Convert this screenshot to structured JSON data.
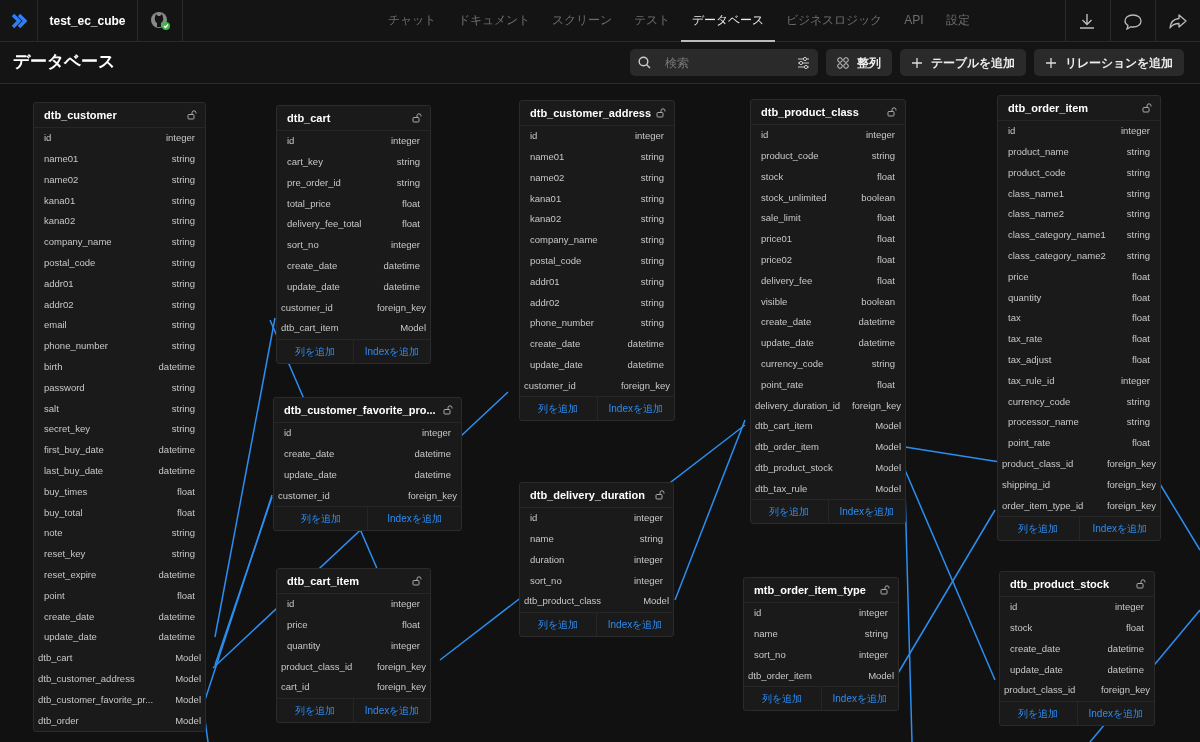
{
  "app": {
    "project": "test_ec_cube"
  },
  "nav": [
    {
      "label": "チャット",
      "selected": false
    },
    {
      "label": "ドキュメント",
      "selected": false
    },
    {
      "label": "スクリーン",
      "selected": false
    },
    {
      "label": "テスト",
      "selected": false
    },
    {
      "label": "データベース",
      "selected": true
    },
    {
      "label": "ビジネスロジック",
      "selected": false
    },
    {
      "label": "API",
      "selected": false
    },
    {
      "label": "設定",
      "selected": false
    }
  ],
  "page": {
    "title": "データベース",
    "search": {
      "placeholder": "検索"
    },
    "buttons": [
      {
        "kind": "arrange",
        "label": "整列"
      },
      {
        "kind": "add",
        "label": "テーブルを追加"
      },
      {
        "kind": "add",
        "label": "リレーションを追加"
      }
    ]
  },
  "tables": [
    {
      "name": "dtb_customer",
      "columns": [
        {
          "name": "id",
          "type": "integer",
          "kind": "field"
        },
        {
          "name": "name01",
          "type": "string",
          "kind": "field"
        },
        {
          "name": "name02",
          "type": "string",
          "kind": "field"
        },
        {
          "name": "kana01",
          "type": "string",
          "kind": "field"
        },
        {
          "name": "kana02",
          "type": "string",
          "kind": "field"
        },
        {
          "name": "company_name",
          "type": "string",
          "kind": "field"
        },
        {
          "name": "postal_code",
          "type": "string",
          "kind": "field"
        },
        {
          "name": "addr01",
          "type": "string",
          "kind": "field"
        },
        {
          "name": "addr02",
          "type": "string",
          "kind": "field"
        },
        {
          "name": "email",
          "type": "string",
          "kind": "field"
        },
        {
          "name": "phone_number",
          "type": "string",
          "kind": "field"
        },
        {
          "name": "birth",
          "type": "datetime",
          "kind": "field"
        },
        {
          "name": "password",
          "type": "string",
          "kind": "field"
        },
        {
          "name": "salt",
          "type": "string",
          "kind": "field"
        },
        {
          "name": "secret_key",
          "type": "string",
          "kind": "field"
        },
        {
          "name": "first_buy_date",
          "type": "datetime",
          "kind": "field"
        },
        {
          "name": "last_buy_date",
          "type": "datetime",
          "kind": "field"
        },
        {
          "name": "buy_times",
          "type": "float",
          "kind": "field"
        },
        {
          "name": "buy_total",
          "type": "float",
          "kind": "field"
        },
        {
          "name": "note",
          "type": "string",
          "kind": "field"
        },
        {
          "name": "reset_key",
          "type": "string",
          "kind": "field"
        },
        {
          "name": "reset_expire",
          "type": "datetime",
          "kind": "field"
        },
        {
          "name": "point",
          "type": "float",
          "kind": "field"
        },
        {
          "name": "create_date",
          "type": "datetime",
          "kind": "field"
        },
        {
          "name": "update_date",
          "type": "datetime",
          "kind": "field"
        },
        {
          "name": "dtb_cart",
          "type": "Model",
          "kind": "link"
        },
        {
          "name": "dtb_customer_address",
          "type": "Model",
          "kind": "link"
        },
        {
          "name": "dtb_customer_favorite_pr...",
          "type": "Model",
          "kind": "link"
        },
        {
          "name": "dtb_order",
          "type": "Model",
          "kind": "link"
        }
      ]
    },
    {
      "name": "dtb_cart",
      "columns": [
        {
          "name": "id",
          "type": "integer",
          "kind": "field"
        },
        {
          "name": "cart_key",
          "type": "string",
          "kind": "field"
        },
        {
          "name": "pre_order_id",
          "type": "string",
          "kind": "field"
        },
        {
          "name": "total_price",
          "type": "float",
          "kind": "field"
        },
        {
          "name": "delivery_fee_total",
          "type": "float",
          "kind": "field"
        },
        {
          "name": "sort_no",
          "type": "integer",
          "kind": "field"
        },
        {
          "name": "create_date",
          "type": "datetime",
          "kind": "field"
        },
        {
          "name": "update_date",
          "type": "datetime",
          "kind": "field"
        },
        {
          "name": "customer_id",
          "type": "foreign_key",
          "kind": "link"
        },
        {
          "name": "dtb_cart_item",
          "type": "Model",
          "kind": "link"
        }
      ],
      "actions": [
        "列を追加",
        "Indexを追加"
      ]
    },
    {
      "name": "dtb_customer_favorite_pro...",
      "columns": [
        {
          "name": "id",
          "type": "integer",
          "kind": "field"
        },
        {
          "name": "create_date",
          "type": "datetime",
          "kind": "field"
        },
        {
          "name": "update_date",
          "type": "datetime",
          "kind": "field"
        },
        {
          "name": "customer_id",
          "type": "foreign_key",
          "kind": "link"
        }
      ],
      "actions": [
        "列を追加",
        "Indexを追加"
      ]
    },
    {
      "name": "dtb_cart_item",
      "columns": [
        {
          "name": "id",
          "type": "integer",
          "kind": "field"
        },
        {
          "name": "price",
          "type": "float",
          "kind": "field"
        },
        {
          "name": "quantity",
          "type": "integer",
          "kind": "field"
        },
        {
          "name": "product_class_id",
          "type": "foreign_key",
          "kind": "link"
        },
        {
          "name": "cart_id",
          "type": "foreign_key",
          "kind": "link"
        }
      ],
      "actions": [
        "列を追加",
        "Indexを追加"
      ]
    },
    {
      "name": "dtb_customer_address",
      "columns": [
        {
          "name": "id",
          "type": "integer",
          "kind": "field"
        },
        {
          "name": "name01",
          "type": "string",
          "kind": "field"
        },
        {
          "name": "name02",
          "type": "string",
          "kind": "field"
        },
        {
          "name": "kana01",
          "type": "string",
          "kind": "field"
        },
        {
          "name": "kana02",
          "type": "string",
          "kind": "field"
        },
        {
          "name": "company_name",
          "type": "string",
          "kind": "field"
        },
        {
          "name": "postal_code",
          "type": "string",
          "kind": "field"
        },
        {
          "name": "addr01",
          "type": "string",
          "kind": "field"
        },
        {
          "name": "addr02",
          "type": "string",
          "kind": "field"
        },
        {
          "name": "phone_number",
          "type": "string",
          "kind": "field"
        },
        {
          "name": "create_date",
          "type": "datetime",
          "kind": "field"
        },
        {
          "name": "update_date",
          "type": "datetime",
          "kind": "field"
        },
        {
          "name": "customer_id",
          "type": "foreign_key",
          "kind": "link"
        }
      ],
      "actions": [
        "列を追加",
        "Indexを追加"
      ]
    },
    {
      "name": "dtb_delivery_duration",
      "columns": [
        {
          "name": "id",
          "type": "integer",
          "kind": "field"
        },
        {
          "name": "name",
          "type": "string",
          "kind": "field"
        },
        {
          "name": "duration",
          "type": "integer",
          "kind": "field"
        },
        {
          "name": "sort_no",
          "type": "integer",
          "kind": "field"
        },
        {
          "name": "dtb_product_class",
          "type": "Model",
          "kind": "link"
        }
      ],
      "actions": [
        "列を追加",
        "Indexを追加"
      ]
    },
    {
      "name": "dtb_product_class",
      "columns": [
        {
          "name": "id",
          "type": "integer",
          "kind": "field"
        },
        {
          "name": "product_code",
          "type": "string",
          "kind": "field"
        },
        {
          "name": "stock",
          "type": "float",
          "kind": "field"
        },
        {
          "name": "stock_unlimited",
          "type": "boolean",
          "kind": "field"
        },
        {
          "name": "sale_limit",
          "type": "float",
          "kind": "field"
        },
        {
          "name": "price01",
          "type": "float",
          "kind": "field"
        },
        {
          "name": "price02",
          "type": "float",
          "kind": "field"
        },
        {
          "name": "delivery_fee",
          "type": "float",
          "kind": "field"
        },
        {
          "name": "visible",
          "type": "boolean",
          "kind": "field"
        },
        {
          "name": "create_date",
          "type": "datetime",
          "kind": "field"
        },
        {
          "name": "update_date",
          "type": "datetime",
          "kind": "field"
        },
        {
          "name": "currency_code",
          "type": "string",
          "kind": "field"
        },
        {
          "name": "point_rate",
          "type": "float",
          "kind": "field"
        },
        {
          "name": "delivery_duration_id",
          "type": "foreign_key",
          "kind": "link"
        },
        {
          "name": "dtb_cart_item",
          "type": "Model",
          "kind": "link"
        },
        {
          "name": "dtb_order_item",
          "type": "Model",
          "kind": "link"
        },
        {
          "name": "dtb_product_stock",
          "type": "Model",
          "kind": "link"
        },
        {
          "name": "dtb_tax_rule",
          "type": "Model",
          "kind": "link"
        }
      ],
      "actions": [
        "列を追加",
        "Indexを追加"
      ]
    },
    {
      "name": "mtb_order_item_type",
      "columns": [
        {
          "name": "id",
          "type": "integer",
          "kind": "field"
        },
        {
          "name": "name",
          "type": "string",
          "kind": "field"
        },
        {
          "name": "sort_no",
          "type": "integer",
          "kind": "field"
        },
        {
          "name": "dtb_order_item",
          "type": "Model",
          "kind": "link"
        }
      ],
      "actions": [
        "列を追加",
        "Indexを追加"
      ]
    },
    {
      "name": "dtb_order_item",
      "columns": [
        {
          "name": "id",
          "type": "integer",
          "kind": "field"
        },
        {
          "name": "product_name",
          "type": "string",
          "kind": "field"
        },
        {
          "name": "product_code",
          "type": "string",
          "kind": "field"
        },
        {
          "name": "class_name1",
          "type": "string",
          "kind": "field"
        },
        {
          "name": "class_name2",
          "type": "string",
          "kind": "field"
        },
        {
          "name": "class_category_name1",
          "type": "string",
          "kind": "field"
        },
        {
          "name": "class_category_name2",
          "type": "string",
          "kind": "field"
        },
        {
          "name": "price",
          "type": "float",
          "kind": "field"
        },
        {
          "name": "quantity",
          "type": "float",
          "kind": "field"
        },
        {
          "name": "tax",
          "type": "float",
          "kind": "field"
        },
        {
          "name": "tax_rate",
          "type": "float",
          "kind": "field"
        },
        {
          "name": "tax_adjust",
          "type": "float",
          "kind": "field"
        },
        {
          "name": "tax_rule_id",
          "type": "integer",
          "kind": "field"
        },
        {
          "name": "currency_code",
          "type": "string",
          "kind": "field"
        },
        {
          "name": "processor_name",
          "type": "string",
          "kind": "field"
        },
        {
          "name": "point_rate",
          "type": "float",
          "kind": "field"
        },
        {
          "name": "product_class_id",
          "type": "foreign_key",
          "kind": "link"
        },
        {
          "name": "shipping_id",
          "type": "foreign_key",
          "kind": "link"
        },
        {
          "name": "order_item_type_id",
          "type": "foreign_key",
          "kind": "link"
        }
      ],
      "actions": [
        "列を追加",
        "Indexを追加"
      ]
    },
    {
      "name": "dtb_product_stock",
      "columns": [
        {
          "name": "id",
          "type": "integer",
          "kind": "field"
        },
        {
          "name": "stock",
          "type": "float",
          "kind": "field"
        },
        {
          "name": "create_date",
          "type": "datetime",
          "kind": "field"
        },
        {
          "name": "update_date",
          "type": "datetime",
          "kind": "field"
        },
        {
          "name": "product_class_id",
          "type": "foreign_key",
          "kind": "link"
        }
      ],
      "actions": [
        "列を追加",
        "Indexを追加"
      ]
    }
  ]
}
